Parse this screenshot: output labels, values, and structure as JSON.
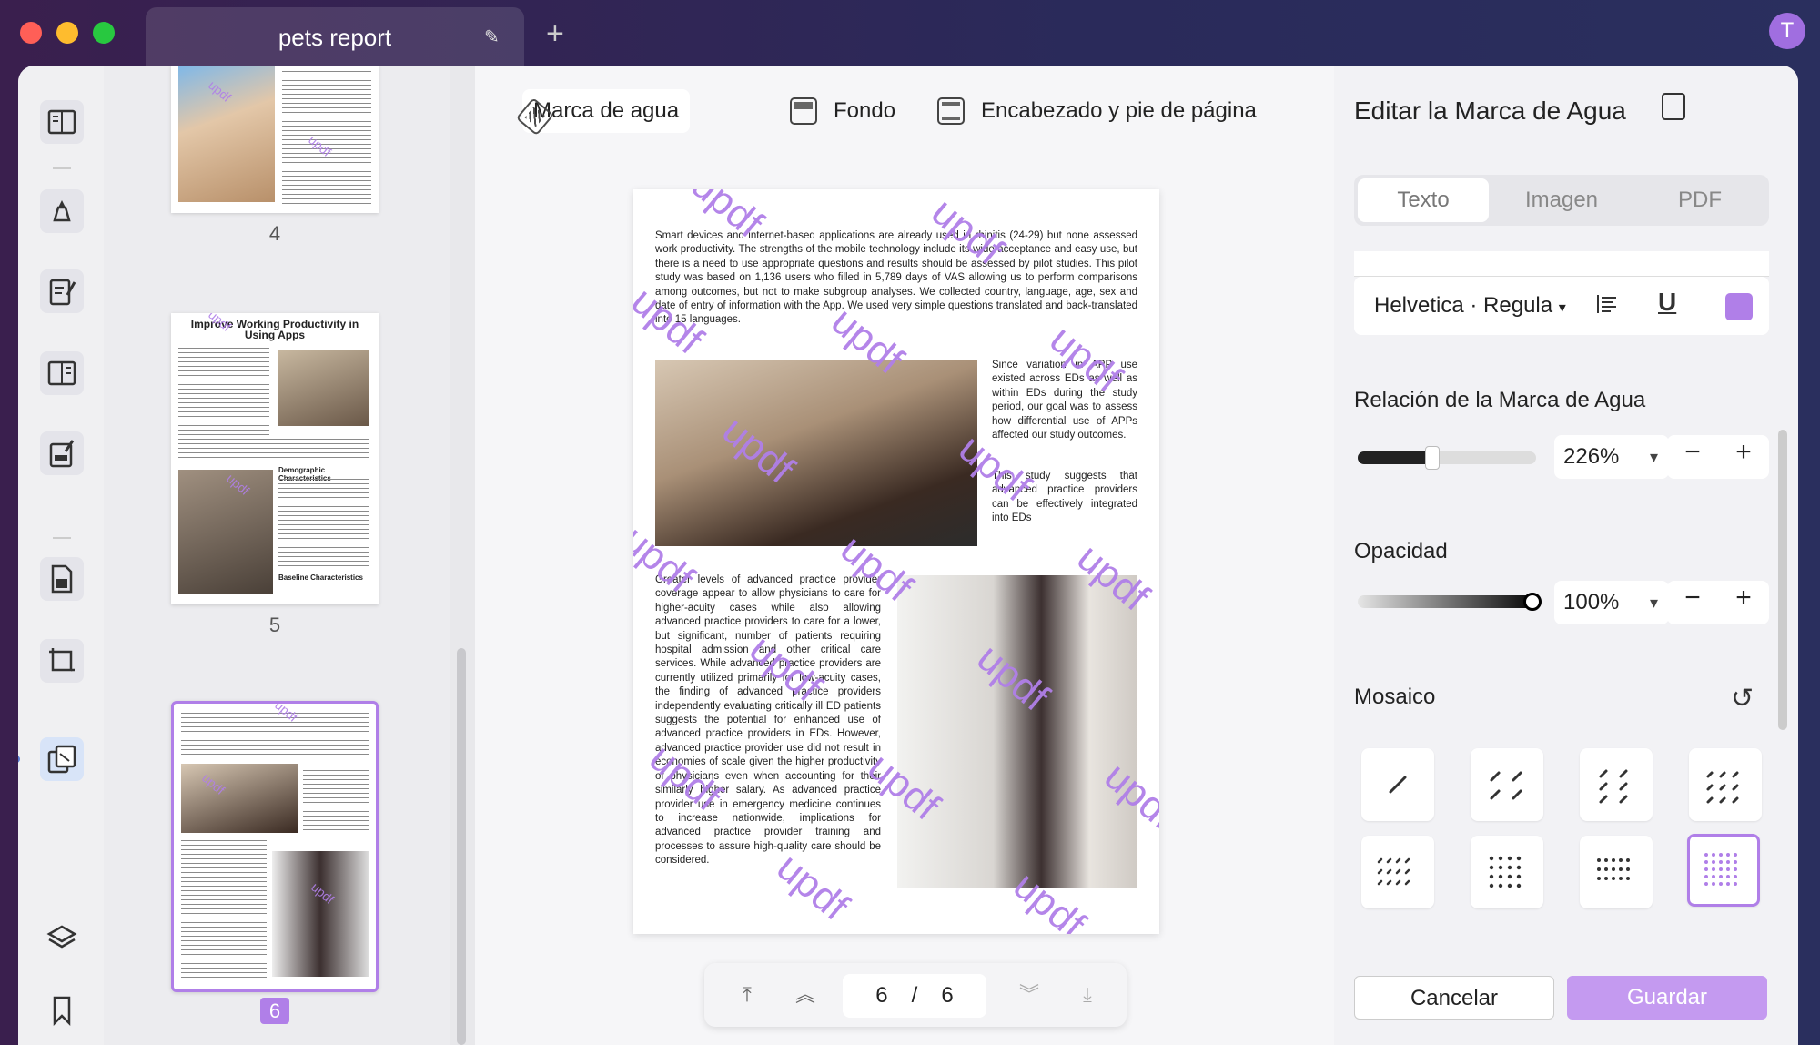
{
  "window": {
    "tab_title": "pets report",
    "avatar_letter": "T"
  },
  "toolbar": {
    "watermark_label": "Marca de agua",
    "background_label": "Fondo",
    "header_footer_label": "Encabezado y pie de página"
  },
  "thumbnails": {
    "pages": [
      {
        "number": "4"
      },
      {
        "number": "5",
        "title": "Improve Working Productivity in Using Apps",
        "heading1": "Demographic Characteristics",
        "heading2": "Baseline Characteristics"
      },
      {
        "number": "6"
      }
    ]
  },
  "document": {
    "para1": "Smart devices and internet-based applications are already used in rhinitis (24-29) but none assessed work productivity. The strengths of the mobile technology include its wide acceptance and easy use, but there is a need to use appropriate questions and results should be assessed by pilot studies. This pilot study was based on 1,136 users who filled in 5,789 days of VAS allowing us to perform comparisons among outcomes, but not to make subgroup analyses. We collected country, language, age, sex and date of entry of information with the App. We used very simple questions translated and back-translated into 15 languages.",
    "para2": "Since variation in APP use existed across EDs as well as within EDs during the study period, our goal was to assess how differential use of APPs affected our study outcomes.",
    "para3": "This study suggests that advanced practice providers can be effectively integrated into EDs",
    "para4": "Greater levels of advanced practice provider coverage appear to allow physicians to care for higher-acuity cases while also allowing advanced practice providers to care for a lower, but significant, number of patients requiring hospital admission and other critical care services. While advanced practice providers are currently utilized primarily for low-acuity cases, the finding of advanced practice providers independently evaluating critically ill ED patients suggests the potential for enhanced use of advanced practice providers in EDs. However, advanced practice provider use did not result in economies of scale given the higher productivity of physicians even when accounting for their similarly higher salary. As advanced practice provider use in emergency medicine continues to increase nationwide, implications for advanced practice provider training and processes to assure high-quality care should be considered.",
    "watermark_text": "updf"
  },
  "pager": {
    "current": "6",
    "separator": "/",
    "total": "6"
  },
  "panel": {
    "title": "Editar la Marca de Agua",
    "tabs": [
      "Texto",
      "Imagen",
      "PDF"
    ],
    "font_name": "Helvetica · Regula",
    "text_color": "#b07fe8",
    "ratio_label": "Relación de la Marca de Agua",
    "ratio_value": "226%",
    "ratio_slider": 0.42,
    "opacity_label": "Opacidad",
    "opacity_value": "100%",
    "opacity_slider": 1.0,
    "mosaic_label": "Mosaico",
    "cancel_label": "Cancelar",
    "save_label": "Guardar"
  },
  "colors": {
    "accent": "#b07fe8",
    "save_button": "#c49af0"
  }
}
